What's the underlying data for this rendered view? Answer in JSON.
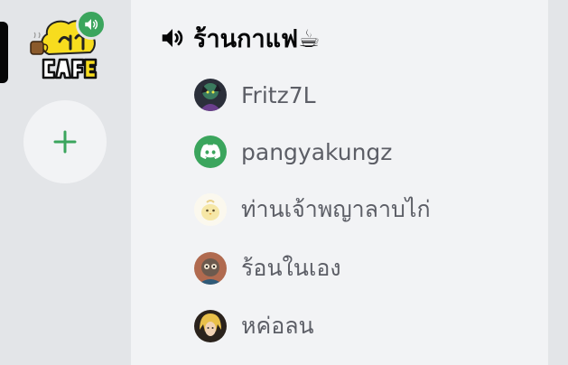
{
  "server_rail": {
    "active_server": {
      "logo_text": "CAFE",
      "logo_icon": "coffee-cup-icon",
      "badge_icon": "speaker-icon"
    },
    "add_server_icon": "plus-icon",
    "colors": {
      "rail_bg": "#e3e5e8",
      "badge_green": "#3ba55d",
      "plus_green": "#3ba55d",
      "active_pill": "#060607"
    }
  },
  "voice_channel": {
    "icon": "speaker-icon",
    "name": "ร้านกาแฟ☕"
  },
  "voice_users": [
    {
      "name": "Fritz7L",
      "avatar": "anime-character-avatar"
    },
    {
      "name": "pangyakungz",
      "avatar": "discord-default-avatar"
    },
    {
      "name": "ท่านเจ้าพญาลาบไก่",
      "avatar": "chick-avatar"
    },
    {
      "name": "ร้อนในเอง",
      "avatar": "cartoon-avatar"
    },
    {
      "name": "หค่อลน",
      "avatar": "blonde-character-avatar"
    }
  ],
  "colors": {
    "panel_bg": "#f2f3f5",
    "channel_text": "#060607",
    "user_text": "#5c5e66",
    "discord_avatar_bg": "#3ba55d"
  }
}
